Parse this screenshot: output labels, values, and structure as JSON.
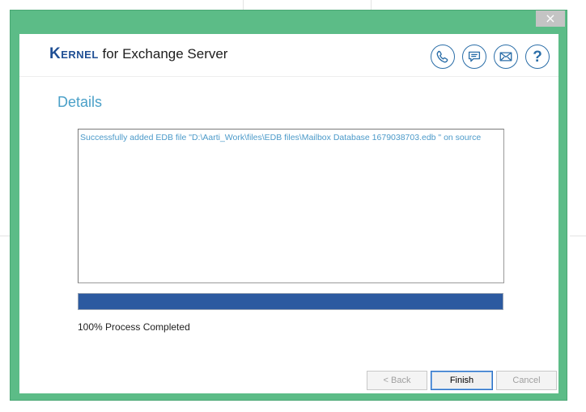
{
  "window": {
    "close_glyph": "×"
  },
  "header": {
    "brand_name": "Kernel",
    "brand_product": " for Exchange Server",
    "icons": [
      "phone-icon",
      "chat-icon",
      "mail-icon",
      "help-icon"
    ],
    "help_glyph": "?"
  },
  "main": {
    "section_title": "Details",
    "log_lines": [
      "Successfully added EDB file \"D:\\Aarti_Work\\files\\EDB files\\Mailbox Database 1679038703.edb \" on source"
    ],
    "progress_percent": 100,
    "progress_label": "100% Process Completed"
  },
  "footer": {
    "back_label": "< Back",
    "finish_label": "Finish",
    "cancel_label": "Cancel"
  },
  "colors": {
    "frame": "#5cbc87",
    "accent": "#2b6ea8",
    "progress": "#2c5aa0",
    "title": "#4aa0c8"
  }
}
